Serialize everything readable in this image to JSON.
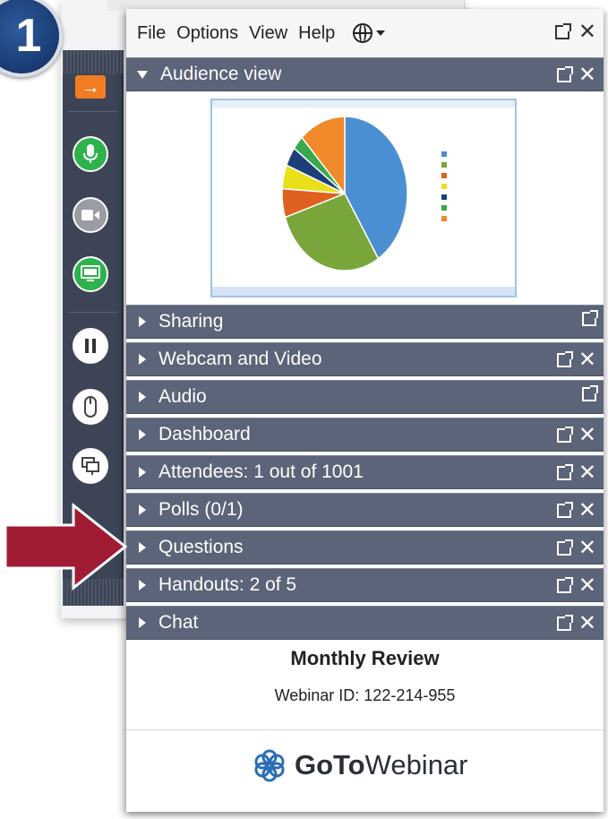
{
  "step_number": "1",
  "menu": {
    "items": [
      "File",
      "Options",
      "View",
      "Help"
    ],
    "globe_icon": "globe-icon"
  },
  "audience_view": {
    "label": "Audience view",
    "chart_data": {
      "type": "pie",
      "values": [
        41,
        29,
        6,
        5,
        4,
        3,
        12
      ],
      "colors": [
        "#4a8fd2",
        "#79a63a",
        "#e0611f",
        "#e9e01b",
        "#1c3f7a",
        "#3aa84c",
        "#f08a2a"
      ]
    }
  },
  "sections": [
    {
      "label": "Sharing",
      "close": false
    },
    {
      "label": "Webcam and Video",
      "close": true
    },
    {
      "label": "Audio",
      "close": false
    },
    {
      "label": "Dashboard",
      "close": true
    },
    {
      "label": "Attendees: 1 out of 1001",
      "close": true
    },
    {
      "label": "Polls (0/1)",
      "close": true
    },
    {
      "label": "Questions",
      "close": true
    },
    {
      "label": "Handouts: 2 of 5",
      "close": true
    },
    {
      "label": "Chat",
      "close": true
    }
  ],
  "footer": {
    "title": "Monthly Review",
    "webinar_id": "Webinar ID: 122-214-955",
    "brand_bold": "GoTo",
    "brand_regular": "Webinar"
  },
  "grabtab": {
    "arrow_glyph": "→",
    "accent": "#f07c24",
    "mic_color": "#2db24e",
    "screen_color": "#2db24e"
  },
  "annotation_arrow_color": "#a01c34"
}
